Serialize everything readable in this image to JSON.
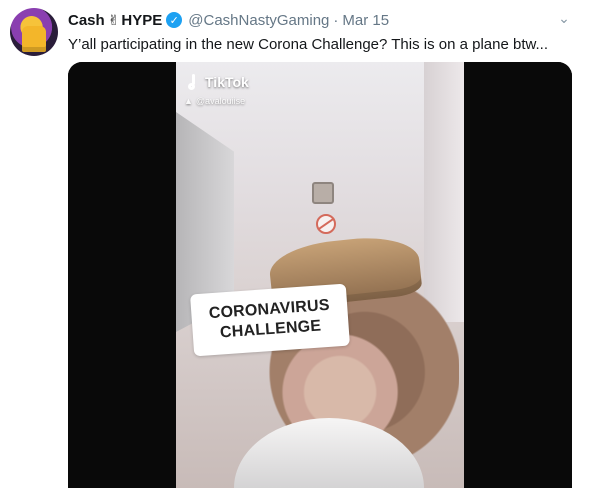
{
  "tweet": {
    "author_name": "Cash",
    "victory_emoji": "✌",
    "author_brand": "HYPE",
    "verified_icon": "verified-badge-icon",
    "handle": "@CashNastyGaming",
    "separator": "·",
    "date": "Mar 15",
    "menu_icon": "chevron-down-icon",
    "text": "Y’all participating in the new Corona Challenge? This is on a plane btw..."
  },
  "media": {
    "tiktok_label": "TikTok",
    "tiktok_user": "@avalouiise",
    "overlay_line1": "CORONAVIRUS",
    "overlay_line2": "CHALLENGE"
  },
  "colors": {
    "text": "#14171a",
    "muted": "#657786",
    "verified": "#1da1f2",
    "media_background": "#0b0b0b"
  }
}
